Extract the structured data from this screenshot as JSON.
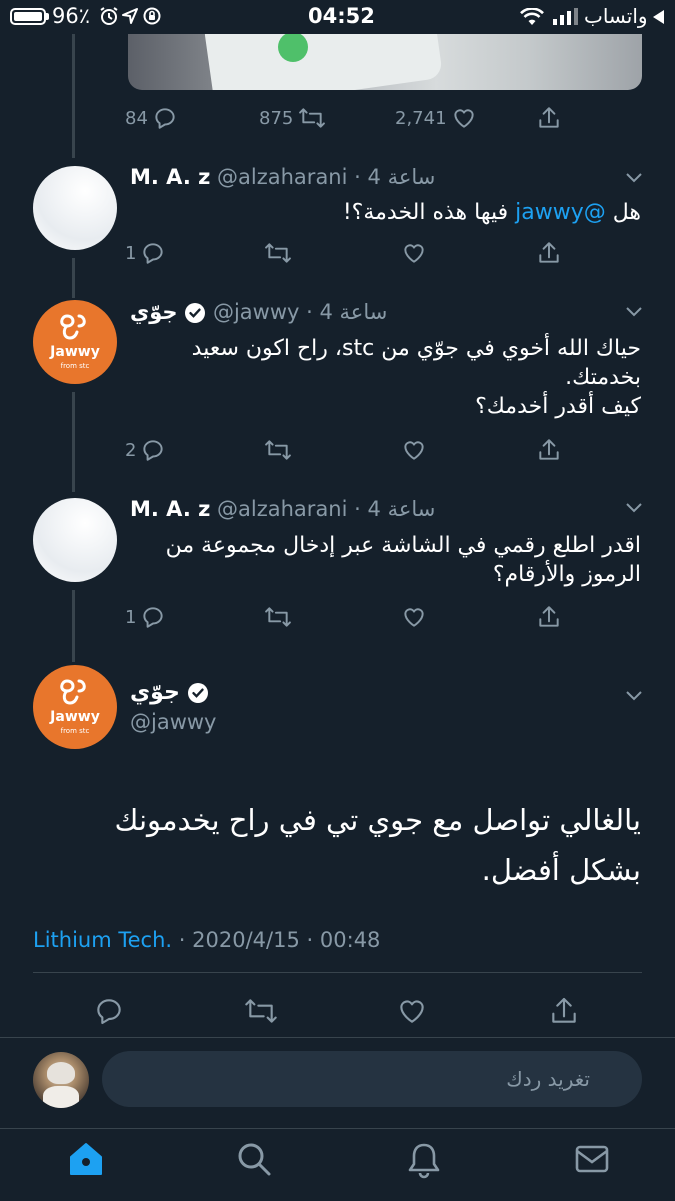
{
  "status_bar": {
    "battery": "96٪",
    "time": "04:52",
    "carrier": "واتساب",
    "icons": [
      "battery-icon",
      "alarm-icon",
      "location-icon",
      "rotation-lock-icon",
      "wifi-icon",
      "signal-icon",
      "back-to-app-icon"
    ]
  },
  "top_tweet_actions": {
    "replies": "84",
    "retweets": "875",
    "likes": "2,741"
  },
  "tweets": [
    {
      "name": "M. A. z",
      "handle": "@alzaharani",
      "time": "4 ساعة",
      "text_before": "هل ",
      "mention": "@jawwy",
      "text_after": " فيها هذه الخدمة؟!",
      "replies": "1"
    },
    {
      "name": "جوّي",
      "handle": "@jawwy",
      "time": "4 ساعة",
      "lines": [
        "حياك الله أخوي في جوّي من stc، راح اكون سعيد",
        "بخدمتك.",
        "كيف أقدر أخدمك؟"
      ],
      "replies": "2"
    },
    {
      "name": "M. A. z",
      "handle": "@alzaharani",
      "time": "4 ساعة",
      "lines": [
        "اقدر اطلع رقمي في الشاشة عبر إدخال مجموعة من",
        "الرموز والأرقام؟"
      ],
      "replies": "1"
    }
  ],
  "main_tweet": {
    "name": "جوّي",
    "handle": "@jawwy",
    "lines": [
      "يالغالي تواصل مع جوي تي في راح يخدمونك",
      "بشكل أفضل."
    ],
    "source": "Lithium Tech.",
    "date": "2020/4/15",
    "time": "00:48"
  },
  "logo": {
    "text": "Jawwy",
    "sub": "from stc"
  },
  "composer": {
    "placeholder": "تغريد ردك"
  },
  "colors": {
    "background": "#15202b",
    "accent": "#1da1f2",
    "muted": "#8899a6",
    "orange": "#e8762c"
  }
}
